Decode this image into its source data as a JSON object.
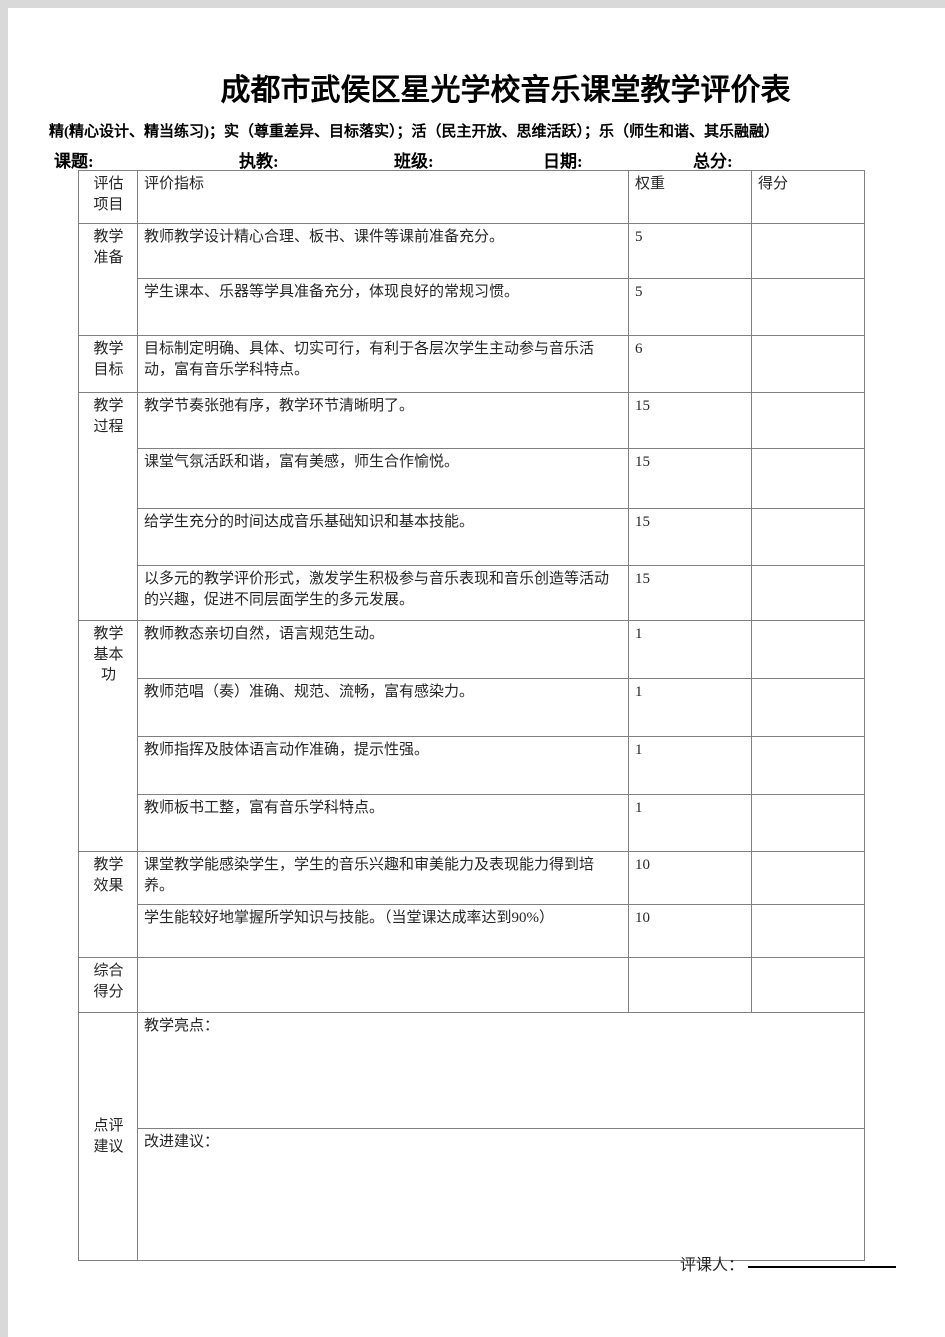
{
  "document": {
    "title": "成都市武侯区星光学校音乐课堂教学评价表",
    "subtitle": "精(精心设计、精当练习)；实（尊重差异、目标落实）；活（民主开放、思维活跃）；乐（师生和谐、其乐融融）"
  },
  "meta_fields": [
    {
      "label": "课题:",
      "value": ""
    },
    {
      "label": "执教:",
      "value": ""
    },
    {
      "label": "班级:",
      "value": ""
    },
    {
      "label": "日期:",
      "value": ""
    },
    {
      "label": "总分:",
      "value": ""
    }
  ],
  "table": {
    "headers": {
      "category": "评估\n项目",
      "category_line1": "评估",
      "category_line2": "项目",
      "indicator": "评价指标",
      "weight": "权重",
      "score": "得分"
    },
    "sections": [
      {
        "category": "教学准备",
        "category_lines": [
          "教学",
          "准备"
        ],
        "rows": [
          {
            "indicator": "教师教学设计精心合理、板书、课件等课前准备充分。",
            "weight": "5",
            "score": ""
          },
          {
            "indicator": "学生课本、乐器等学具准备充分，体现良好的常规习惯。",
            "weight": "5",
            "score": ""
          }
        ]
      },
      {
        "category": "教学目标",
        "category_lines": [
          "教学",
          "目标"
        ],
        "rows": [
          {
            "indicator": "目标制定明确、具体、切实可行，有利于各层次学生主动参与音乐活动，富有音乐学科特点。",
            "weight": "6",
            "score": ""
          }
        ]
      },
      {
        "category": "教学过程",
        "category_lines": [
          "教学",
          "过程"
        ],
        "rows": [
          {
            "indicator": "教学节奏张弛有序，教学环节清晰明了。",
            "weight": "15",
            "score": ""
          },
          {
            "indicator": "课堂气氛活跃和谐，富有美感，师生合作愉悦。",
            "weight": "15",
            "score": ""
          },
          {
            "indicator": "给学生充分的时间达成音乐基础知识和基本技能。",
            "weight": "15",
            "score": ""
          },
          {
            "indicator": "以多元的教学评价形式，激发学生积极参与音乐表现和音乐创造等活动的兴趣，促进不同层面学生的多元发展。",
            "weight": "15",
            "score": ""
          }
        ]
      },
      {
        "category": "教学基本功",
        "category_lines": [
          "教学",
          "基本",
          "功"
        ],
        "rows": [
          {
            "indicator": "教师教态亲切自然，语言规范生动。",
            "weight": "1",
            "score": ""
          },
          {
            "indicator": "教师范唱（奏）准确、规范、流畅，富有感染力。",
            "weight": "1",
            "score": ""
          },
          {
            "indicator": "教师指挥及肢体语言动作准确，提示性强。",
            "weight": "1",
            "score": ""
          },
          {
            "indicator": "教师板书工整，富有音乐学科特点。",
            "weight": "1",
            "score": ""
          }
        ]
      },
      {
        "category": "教学效果",
        "category_lines": [
          "教学",
          "效果"
        ],
        "rows": [
          {
            "indicator": "课堂教学能感染学生，学生的音乐兴趣和审美能力及表现能力得到培养。",
            "weight": "10",
            "score": ""
          },
          {
            "indicator": "学生能较好地掌握所学知识与技能。（当堂课达成率达到90%）",
            "weight": "10",
            "score": ""
          }
        ]
      },
      {
        "category": "综合得分",
        "category_lines": [
          "综合",
          "得分"
        ],
        "rows": [
          {
            "indicator": "",
            "weight": "",
            "score": ""
          }
        ]
      }
    ],
    "comment_section": {
      "category": "点评建议",
      "category_lines": [
        "点评",
        "建议"
      ],
      "blocks": [
        {
          "label": "教学亮点：",
          "value": ""
        },
        {
          "label": "改进建议：",
          "value": ""
        }
      ]
    }
  },
  "footer": {
    "reviewer_label": "评课人：",
    "reviewer_value": ""
  }
}
